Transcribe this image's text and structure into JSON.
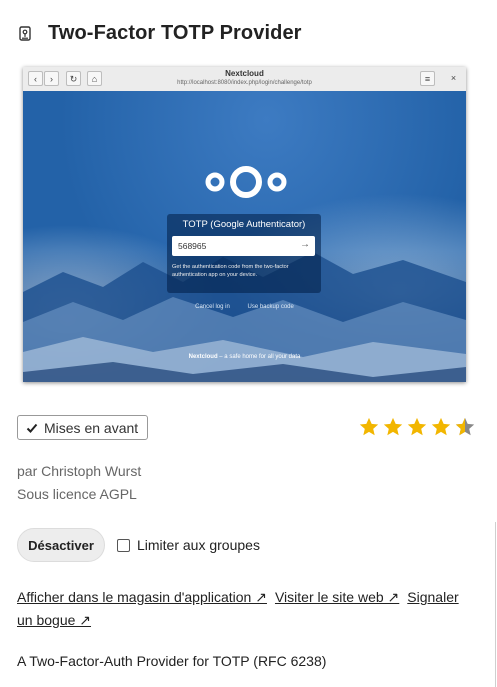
{
  "app": {
    "title": "Two-Factor TOTP Provider",
    "icon": "app-icon"
  },
  "screenshot": {
    "window_title": "Nextcloud",
    "url": "http://localhost:8080/index.php/login/challenge/totp",
    "totp_title": "TOTP (Google Authenticator)",
    "code_value": "568965",
    "help_text": "Get the authentication code from the two-factor authentication app on your device.",
    "cancel_link": "Cancel log in",
    "backup_link": "Use backup code",
    "footer_brand": "Nextcloud",
    "footer_tagline": " – a safe home for all your data"
  },
  "badge": {
    "featured_label": "Mises en avant",
    "icon": "checkmark-icon"
  },
  "rating": {
    "value": 4.5,
    "max": 5
  },
  "meta": {
    "author": "par Christoph Wurst",
    "license": "Sous licence AGPL"
  },
  "actions": {
    "disable_label": "Désactiver",
    "limit_label": "Limiter aux groupes",
    "limit_checked": false
  },
  "links": {
    "store": "Afficher dans le magasin d'application ↗",
    "website": "Visiter le site web ↗",
    "bug": "Signaler un bogue ↗"
  },
  "description": "A Two-Factor-Auth Provider for TOTP (RFC 6238)",
  "colors": {
    "star": "#f2b600",
    "star_empty": "#888888",
    "screenshot_bg": "#2362a8"
  }
}
